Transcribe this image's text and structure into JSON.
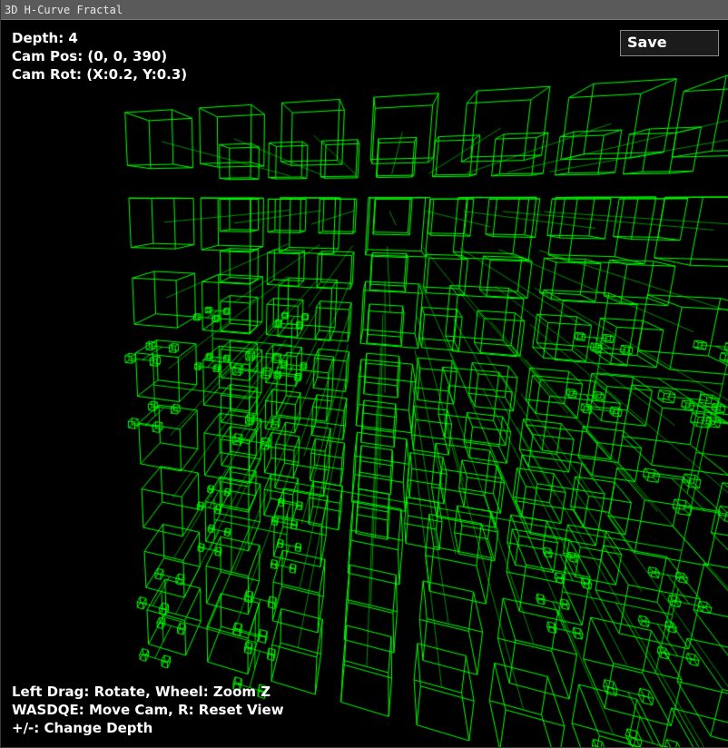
{
  "window": {
    "title": "3D H-Curve Fractal"
  },
  "hud": {
    "depth": "Depth: 4",
    "cam_pos": "Cam Pos: (0, 0, 390)",
    "cam_rot": "Cam Rot: (X:0.2, Y:0.3)"
  },
  "toolbar": {
    "save_label": "Save"
  },
  "help": {
    "line1": "Left Drag: Rotate, Wheel: Zoom Z",
    "line2": "WASDQE: Move Cam, R: Reset View",
    "line3": "+/-: Change Depth"
  },
  "scene": {
    "depth": 4,
    "camera": {
      "x": 0,
      "y": 0,
      "z": 390,
      "rot_x": 0.2,
      "rot_y": 0.3
    },
    "wire_color": "#00ff00",
    "background": "#000000"
  }
}
